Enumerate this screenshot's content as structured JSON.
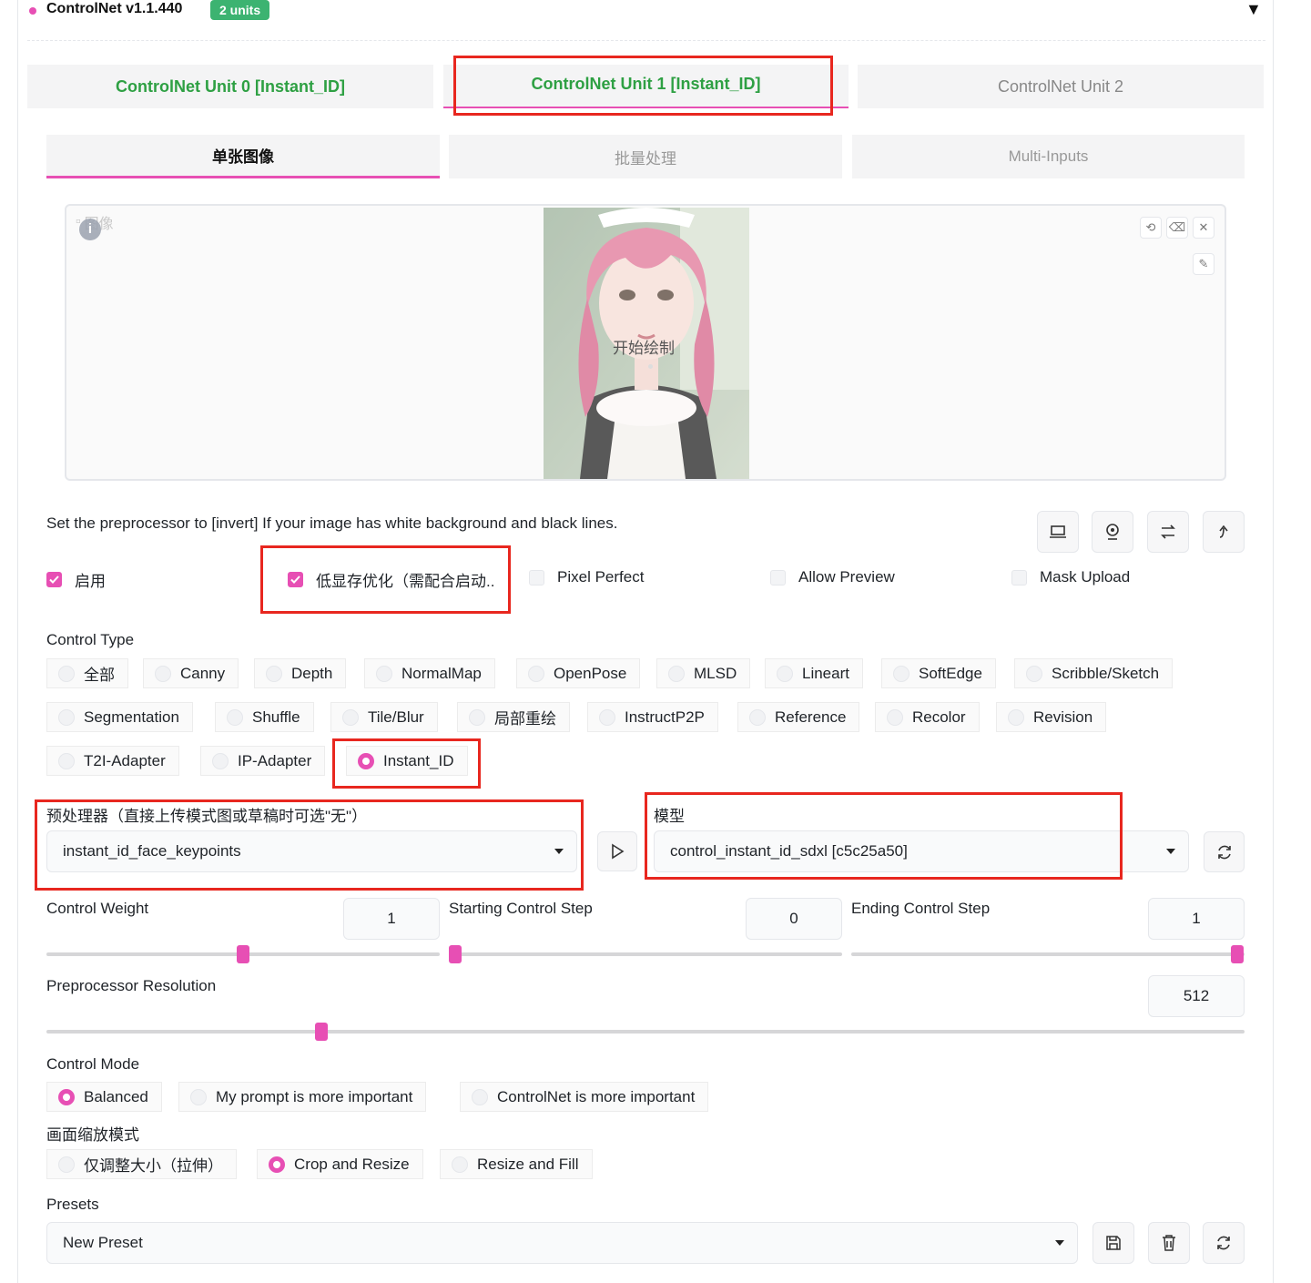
{
  "header": {
    "title": "ControlNet v1.1.440",
    "badge": "2 units",
    "collapse_glyph": "▼"
  },
  "unit_tabs": [
    {
      "label": "ControlNet Unit 0 [Instant_ID]"
    },
    {
      "label": "ControlNet Unit 1 [Instant_ID]",
      "selected": true
    },
    {
      "label": "ControlNet Unit 2"
    }
  ],
  "input_tabs": [
    {
      "label": "单张图像",
      "selected": true
    },
    {
      "label": "批量处理"
    },
    {
      "label": "Multi-Inputs"
    }
  ],
  "image": {
    "label": "图像",
    "center_label": "开始绘制",
    "tool_icons": [
      "undo-icon",
      "eraser-icon",
      "close-icon",
      "brush-icon"
    ]
  },
  "hint_text": "Set the preprocessor to [invert] If your image has white background and black lines.",
  "side_buttons": [
    "laptop-icon",
    "webcam-icon",
    "swap-icon",
    "send-up-icon"
  ],
  "checkboxes": [
    {
      "label": "启用",
      "checked": true
    },
    {
      "label": "低显存优化（需配合启动..",
      "checked": true
    },
    {
      "label": "Pixel Perfect",
      "checked": false
    },
    {
      "label": "Allow Preview",
      "checked": false
    },
    {
      "label": "Mask Upload",
      "checked": false
    }
  ],
  "control_type": {
    "label": "Control Type",
    "options": [
      "全部",
      "Canny",
      "Depth",
      "NormalMap",
      "OpenPose",
      "MLSD",
      "Lineart",
      "SoftEdge",
      "Scribble/Sketch",
      "Segmentation",
      "Shuffle",
      "Tile/Blur",
      "局部重绘",
      "InstructP2P",
      "Reference",
      "Recolor",
      "Revision",
      "T2I-Adapter",
      "IP-Adapter",
      "Instant_ID"
    ],
    "selected": "Instant_ID"
  },
  "preprocessor": {
    "label": "预处理器（直接上传模式图或草稿时可选\"无\"）",
    "value": "instant_id_face_keypoints"
  },
  "model": {
    "label": "模型",
    "value": "control_instant_id_sdxl [c5c25a50]"
  },
  "sliders": {
    "control_weight": {
      "label": "Control Weight",
      "value": "1",
      "fraction": 0.5
    },
    "starting_step": {
      "label": "Starting Control Step",
      "value": "0",
      "fraction": 0.0
    },
    "ending_step": {
      "label": "Ending Control Step",
      "value": "1",
      "fraction": 1.0
    },
    "preprocessor_resolution": {
      "label": "Preprocessor Resolution",
      "value": "512",
      "fraction": 0.23
    }
  },
  "control_mode": {
    "label": "Control Mode",
    "options": [
      "Balanced",
      "My prompt is more important",
      "ControlNet is more important"
    ],
    "selected": "Balanced"
  },
  "resize_mode": {
    "label": "画面缩放模式",
    "options": [
      "仅调整大小（拉伸）",
      "Crop and Resize",
      "Resize and Fill"
    ],
    "selected": "Crop and Resize"
  },
  "presets": {
    "label": "Presets",
    "value": "New Preset",
    "buttons": [
      "save-icon",
      "delete-icon",
      "refresh-icon"
    ]
  },
  "colors": {
    "accent": "#e74fb4",
    "unit_tab_text": "#2ea043",
    "badge_bg": "#3cb371",
    "highlight": "#e8271f"
  }
}
